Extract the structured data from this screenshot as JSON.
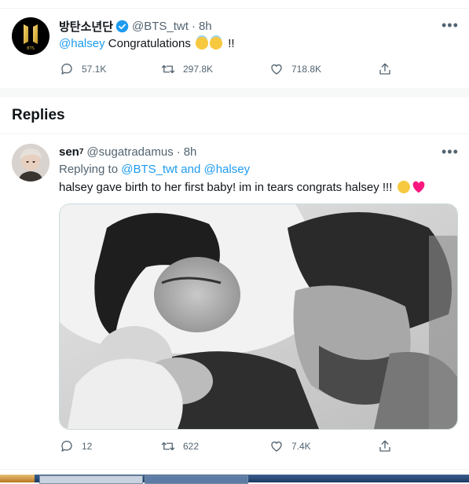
{
  "tweet": {
    "display_name": "방탄소년단",
    "handle": "@BTS_twt",
    "dot": "·",
    "time": "8h",
    "mention": "@halsey",
    "text": "Congratulations",
    "text_tail": "!!",
    "stats": {
      "replies": "57.1K",
      "retweets": "297.8K",
      "likes": "718.8K"
    },
    "more": "•••",
    "logo_text": "BTS"
  },
  "section": {
    "title": "Replies"
  },
  "reply": {
    "display_name": "sen",
    "name_sup": "7",
    "handle": "@sugatradamus",
    "dot": "·",
    "time": "8h",
    "replying_prefix": "Replying to",
    "replying_to": "@BTS_twt and @halsey",
    "text": "halsey gave birth to her first baby! im in tears congrats halsey !!!",
    "stats": {
      "replies": "12",
      "retweets": "622",
      "likes": "7.4K"
    },
    "more": "•••"
  },
  "colors": {
    "accent": "#1d9bf0",
    "muted": "#536471",
    "verified": "#1d9bf0",
    "heart_emoji": "#f91880"
  }
}
